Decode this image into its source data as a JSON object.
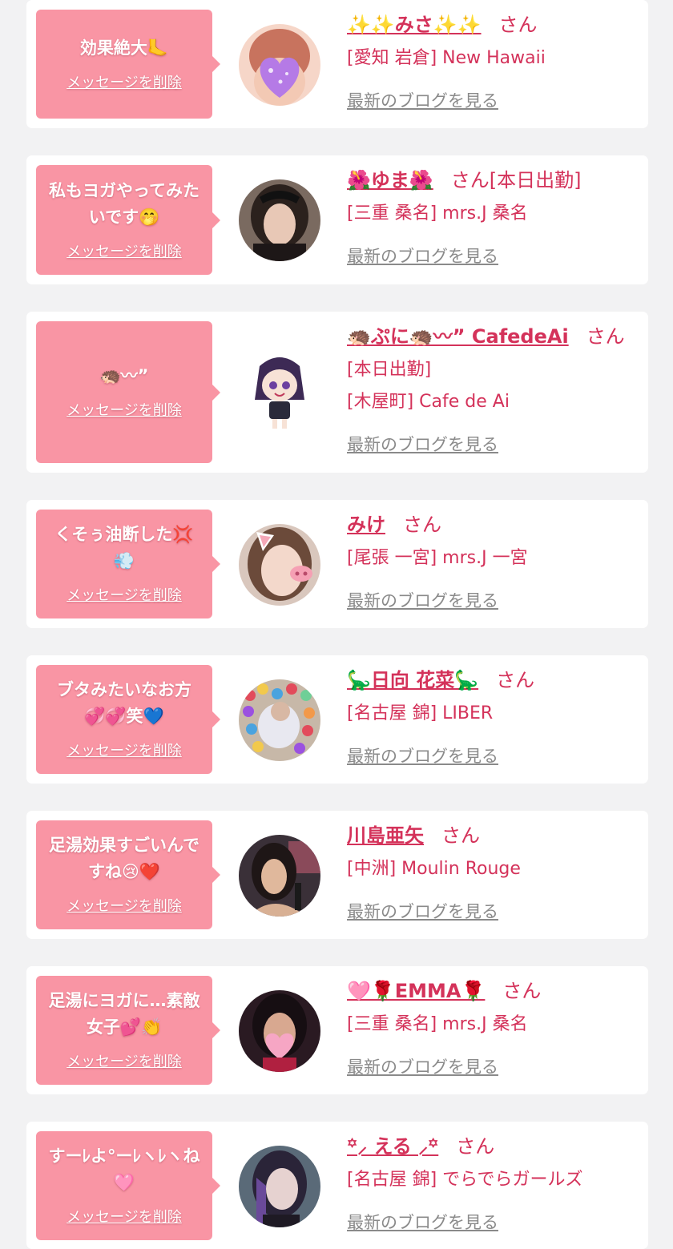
{
  "messages": [
    {
      "message": "効果絶大🦶",
      "delete_label": "メッセージを削除",
      "name": "✨✨みさ✨✨",
      "honorific": "さん",
      "name_extra": "",
      "name_color": "#d4325a",
      "shop_lines": [
        "[愛知 岩倉] New Hawaii"
      ],
      "blog_label": "最新のブログを見る",
      "avatar_icon": "heart-sticker-photo-icon"
    },
    {
      "message": "私もヨガやってみたいです🤭",
      "delete_label": "メッセージを削除",
      "name": "🌺ゆま🌺",
      "honorific": "さん[本日出勤]",
      "name_extra": "",
      "name_color": "#d4325a",
      "shop_lines": [
        "[三重 桑名] mrs.J 桑名"
      ],
      "blog_label": "最新のブログを見る",
      "avatar_icon": "woman-photo-icon"
    },
    {
      "message": "🦔〰”",
      "delete_label": "メッセージを削除",
      "name": "🦔ぷに🦔〰” CafedeAi",
      "honorific": "さん",
      "name_extra": "",
      "name_color": "#d4325a",
      "shop_lines": [
        "[本日出勤]",
        "[木屋町] Cafe de Ai"
      ],
      "blog_label": "最新のブログを見る",
      "avatar_icon": "anime-character-icon"
    },
    {
      "message": "くそぅ油断した💢💨",
      "delete_label": "メッセージを削除",
      "name": "みけ",
      "honorific": "さん",
      "name_extra": "",
      "name_color": "#d4325a",
      "shop_lines": [
        "[尾張 一宮] mrs.J 一宮"
      ],
      "blog_label": "最新のブログを見る",
      "avatar_icon": "pig-filter-photo-icon"
    },
    {
      "message": "ブタみたいなお方💞💞笑💙",
      "delete_label": "メッセージを削除",
      "name": "🦕日向 花菜🦕",
      "honorific": "さん",
      "name_extra": "",
      "name_color": "#d4325a",
      "shop_lines": [
        "[名古屋 錦] LIBER"
      ],
      "blog_label": "最新のブログを見る",
      "avatar_icon": "ball-pit-photo-icon"
    },
    {
      "message": "足湯効果すごいんですね😢❤️",
      "delete_label": "メッセージを削除",
      "name": "川島亜矢",
      "honorific": "さん",
      "name_extra": "",
      "name_color": "#d4325a",
      "shop_lines": [
        "[中洲] Moulin Rouge"
      ],
      "blog_label": "最新のブログを見る",
      "avatar_icon": "woman-photo-icon"
    },
    {
      "message": "足湯にヨガに…素敵女子💕👏",
      "delete_label": "メッセージを削除",
      "name": "🩷🌹EMMA🌹",
      "honorific": "さん",
      "name_extra": "",
      "name_color": "#d4325a",
      "shop_lines": [
        "[三重 桑名] mrs.J 桑名"
      ],
      "blog_label": "最新のブログを見る",
      "avatar_icon": "emma-sticker-photo-icon"
    },
    {
      "message": "すーﾚよ°ーﾚヽﾚヽね🩷",
      "delete_label": "メッセージを削除",
      "name": "꙳⸝ える ⸝꙳",
      "honorific": "さん",
      "name_extra": "",
      "name_color": "#d4325a",
      "shop_lines": [
        "[名古屋 錦] でらでらガールズ"
      ],
      "blog_label": "最新のブログを見る",
      "avatar_icon": "woman-photo-icon"
    }
  ]
}
